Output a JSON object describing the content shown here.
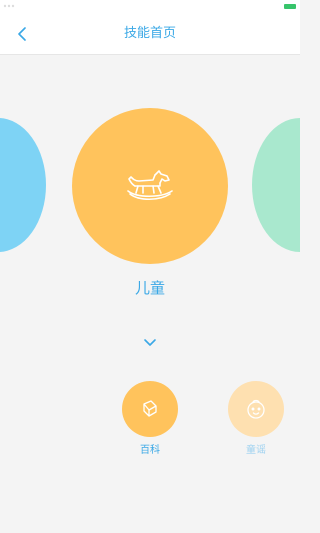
{
  "nav": {
    "title": "技能首页"
  },
  "carousel": {
    "current_skill": "儿童",
    "colors": {
      "left": "#7ed3f5",
      "main": "#ffc35c",
      "right": "#a9e8ce"
    }
  },
  "sub_items": [
    {
      "label": "百科",
      "icon": "book-icon",
      "color": "#ffc35c"
    },
    {
      "label": "童谣",
      "icon": "baby-face-icon",
      "color": "#fee0b0"
    }
  ],
  "colors": {
    "accent": "#3aa8e6",
    "background": "#f4f4f4",
    "battery": "#37c46b"
  }
}
